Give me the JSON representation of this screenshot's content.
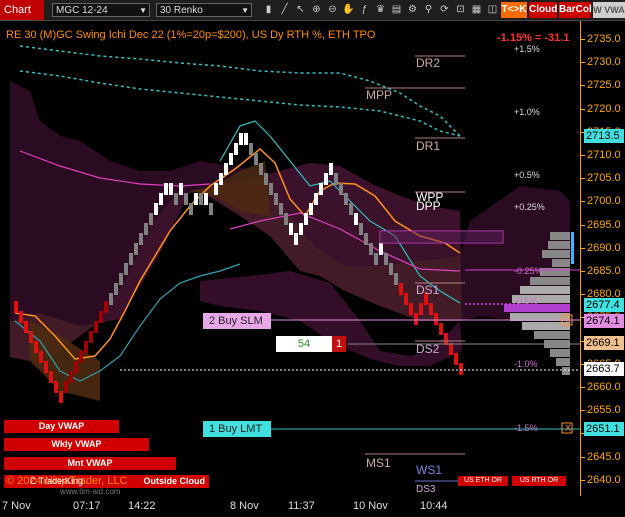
{
  "toolbar": {
    "chart_label": "Chart",
    "instrument": "MGC 12-24",
    "bar_type": "30 Renko",
    "tag_tk": "T<>K",
    "tag_cloud": "Cloud",
    "tag_barcol": "BarCol",
    "tag_w": "W VWA",
    "colors": {
      "tk": "#ff6a00",
      "cloud": "#cc0000",
      "barcol": "#cc0000"
    }
  },
  "chart_title": "RE 30 (M)GC Swing Ichi Dec 22 (1%=20p=$200), US Dy RTH %, ETH TPO",
  "session_change": "-1.15% = -31.1",
  "price_axis": {
    "ticks": [
      "2735.0",
      "2730.0",
      "2725.0",
      "2720.0",
      "2715.0",
      "2710.0",
      "2705.0",
      "2700.0",
      "2695.0",
      "2690.0",
      "2685.0",
      "2680.0",
      "2675.0",
      "2670.0",
      "2665.0",
      "2660.0",
      "2655.0",
      "2650.0",
      "2645.0",
      "2640.0"
    ],
    "price_labels": [
      {
        "value": "2713.5",
        "color": "#40e0e0"
      },
      {
        "value": "2677.4",
        "color": "#40e0e0"
      },
      {
        "value": "2674.1",
        "color": "#e08ce0"
      },
      {
        "value": "2669.1",
        "color": "#f0c090"
      },
      {
        "value": "2663.7",
        "color": "#ffffff"
      },
      {
        "value": "2651.1",
        "color": "#40e0e0"
      }
    ]
  },
  "time_axis": [
    "7 Nov",
    "07:17",
    "14:22",
    "8 Nov",
    "11:37",
    "10 Nov",
    "10:44"
  ],
  "levels": {
    "dr2": "DR2",
    "mpp": "MPP",
    "dr1": "DR1",
    "wpp": "WPP",
    "dpp": "DPP",
    "ds1": "DS1",
    "ds2": "DS2",
    "ms1": "MS1",
    "ws1": "WS1",
    "ds3": "DS3"
  },
  "percent_levels": [
    "+1.5%",
    "+1.0%",
    "+0.5%",
    "+0.25%",
    "-0.25%",
    "-0.5%",
    "-1.0%",
    "-1.5%"
  ],
  "orders": {
    "sell": "2 Buy SLM",
    "buy": "1 Buy LMT",
    "qty": "54",
    "qty_tag": "1",
    "close_mark": "X"
  },
  "vwap_bars": [
    "Day VWAP",
    "Wkly VWAP",
    "Mnt VWAP",
    "Outside Cloud"
  ],
  "bottom_tags": [
    "US ETH OR",
    "US RTH OR"
  ],
  "copyright": "© 2024 NinjaTrader, LLC",
  "watermark": "C TraderKing",
  "watermark2": "www.tim-aid.com"
}
